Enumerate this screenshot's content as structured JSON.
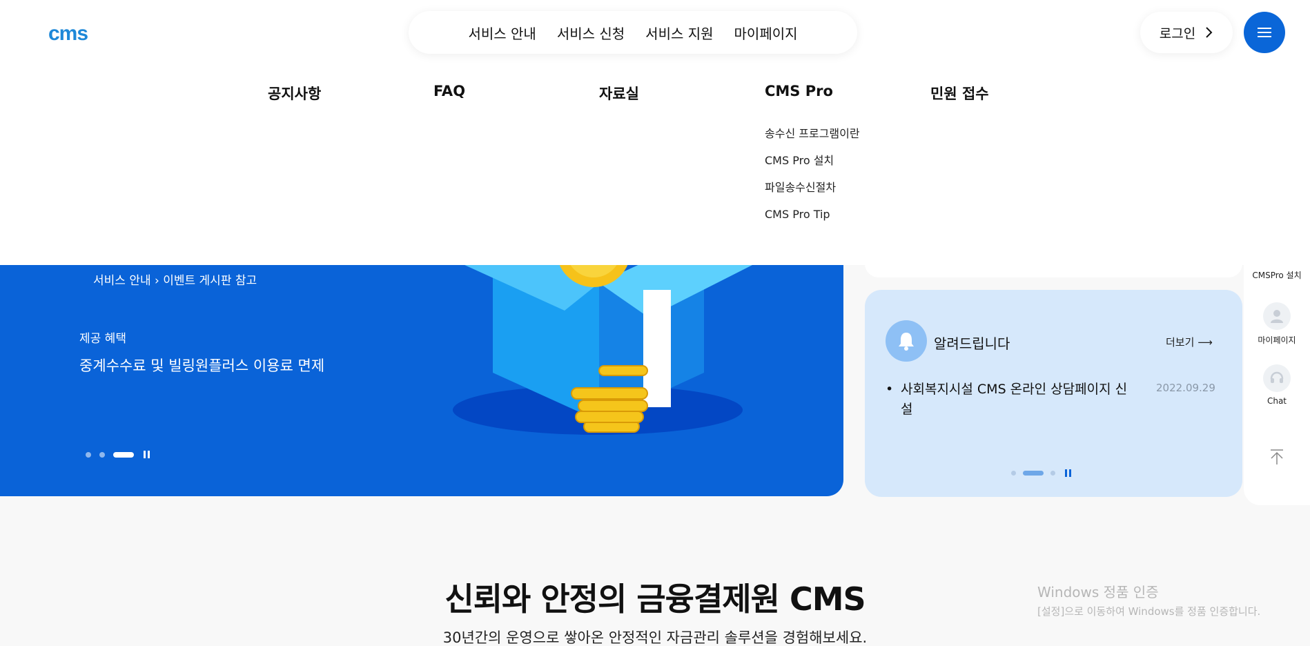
{
  "header": {
    "logo": "cms",
    "nav": [
      "서비스 안내",
      "서비스 신청",
      "서비스 지원",
      "마이페이지"
    ],
    "login_label": "로그인",
    "menu_icon": "hamburger-icon"
  },
  "megamenu": {
    "columns": [
      {
        "title": "공지사항",
        "items": []
      },
      {
        "title": "FAQ",
        "items": []
      },
      {
        "title": "자료실",
        "items": []
      },
      {
        "title": "CMS Pro",
        "items": [
          "송수신 프로그램이란",
          "CMS Pro 설치",
          "파일송수신절차",
          "CMS Pro Tip"
        ]
      },
      {
        "title": "민원 접수",
        "items": []
      }
    ]
  },
  "hero": {
    "line1": "서비스 안내 › 이벤트 게시판 참고",
    "benefit_label": "제공 혜택",
    "benefit_text": "중계수수료 및 빌링원플러스 이용료 면제",
    "slides_total": 3,
    "active_slide": 3,
    "bg_color": "#0a63d8"
  },
  "notice": {
    "title": "알려드립니다",
    "more_label": "더보기",
    "items": [
      {
        "text": "사회복지시설 CMS 온라인 상담페이지 신설",
        "date": "2022.09.29"
      }
    ],
    "slides_total": 3,
    "active_slide": 2
  },
  "quickbar": {
    "items": [
      {
        "label": "CMSPro 설치",
        "icon": "download-icon"
      },
      {
        "label": "마이페이지",
        "icon": "user-icon"
      },
      {
        "label": "Chat",
        "icon": "headset-icon"
      }
    ],
    "top_icon": "arrow-up-icon"
  },
  "main": {
    "title": "신뢰와 안정의 금융결제원 CMS",
    "subtitle": "30년간의 운영으로 쌓아온 안정적인 자금관리 솔루션을 경험해보세요."
  },
  "watermark": {
    "line1": "Windows 정품 인증",
    "line2": "[설정]으로 이동하여 Windows를 정품 인증합니다."
  }
}
